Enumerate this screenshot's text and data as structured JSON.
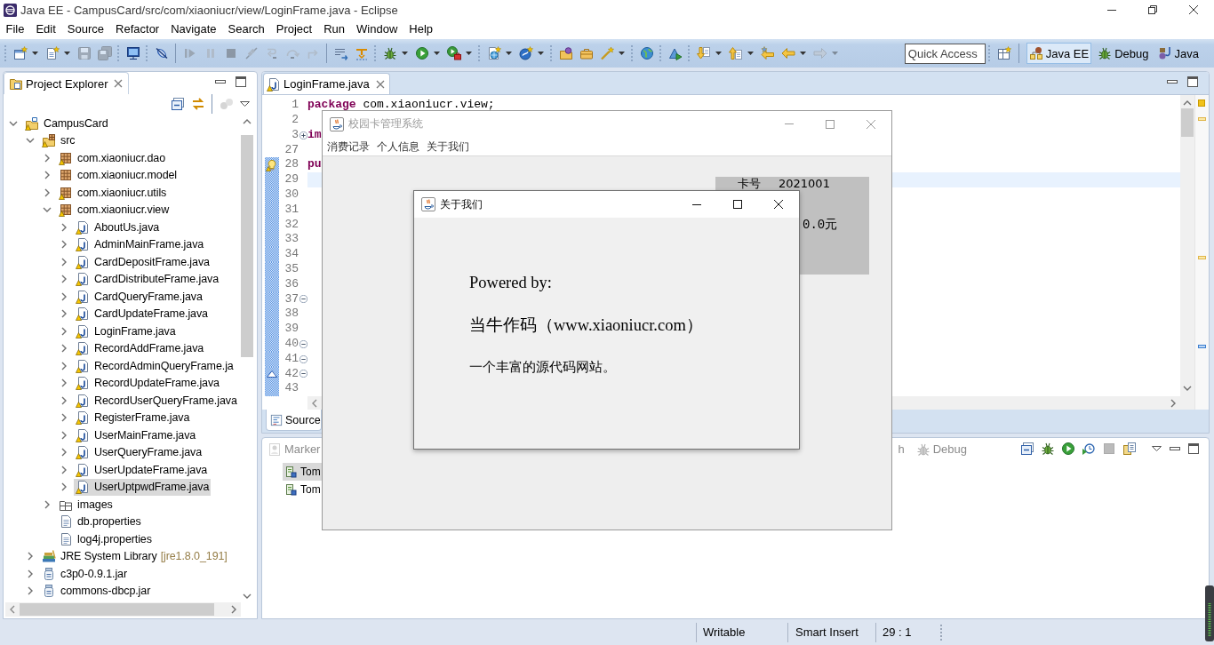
{
  "window": {
    "title": "Java EE - CampusCard/src/com/xiaoniucr/view/LoginFrame.java - Eclipse"
  },
  "menu": [
    "File",
    "Edit",
    "Source",
    "Refactor",
    "Navigate",
    "Search",
    "Project",
    "Run",
    "Window",
    "Help"
  ],
  "toolbar": [
    {
      "kind": "grip",
      "items": [
        {
          "kind": "new",
          "disabled": false,
          "dropdown": true
        },
        {
          "kind": "newfile",
          "disabled": false,
          "dropdown": true
        },
        {
          "kind": "save",
          "disabled": true,
          "dropdown": false
        },
        {
          "kind": "saveall",
          "disabled": true,
          "dropdown": false
        }
      ]
    },
    {
      "kind": "grip",
      "items": [
        {
          "kind": "console",
          "disabled": false,
          "dropdown": false
        }
      ]
    },
    {
      "kind": "grip",
      "items": [
        {
          "kind": "skip",
          "disabled": false,
          "dropdown": false
        }
      ]
    },
    {
      "kind": "line",
      "items": [
        {
          "kind": "resume",
          "disabled": true,
          "dropdown": false
        },
        {
          "kind": "suspend",
          "disabled": true,
          "dropdown": false
        },
        {
          "kind": "terminate",
          "disabled": true,
          "dropdown": false
        },
        {
          "kind": "disconnect",
          "disabled": true,
          "dropdown": false
        },
        {
          "kind": "stepinto",
          "disabled": true,
          "dropdown": false
        },
        {
          "kind": "stepover",
          "disabled": true,
          "dropdown": false
        },
        {
          "kind": "stepreturn",
          "disabled": true,
          "dropdown": false
        }
      ]
    },
    {
      "kind": "line",
      "items": [
        {
          "kind": "dropframe",
          "disabled": false,
          "dropdown": false
        },
        {
          "kind": "stepfilter",
          "disabled": false,
          "dropdown": false
        }
      ]
    },
    {
      "kind": "grip",
      "items": [
        {
          "kind": "debug",
          "disabled": false,
          "dropdown": true
        },
        {
          "kind": "run",
          "disabled": false,
          "dropdown": true
        },
        {
          "kind": "tools",
          "disabled": false,
          "dropdown": true
        }
      ]
    },
    {
      "kind": "grip",
      "items": [
        {
          "kind": "server",
          "disabled": false,
          "dropdown": true
        },
        {
          "kind": "servlet",
          "disabled": false,
          "dropdown": true
        }
      ]
    },
    {
      "kind": "grip",
      "items": [
        {
          "kind": "openfolder",
          "disabled": false,
          "dropdown": false
        },
        {
          "kind": "briefcase",
          "disabled": false,
          "dropdown": false
        },
        {
          "kind": "wand",
          "disabled": false,
          "dropdown": true
        }
      ]
    },
    {
      "kind": "grip",
      "items": [
        {
          "kind": "globe",
          "disabled": false,
          "dropdown": false
        }
      ]
    },
    {
      "kind": "grip",
      "items": [
        {
          "kind": "launch",
          "disabled": false,
          "dropdown": false
        }
      ]
    },
    {
      "kind": "grip",
      "items": [
        {
          "kind": "nextann",
          "disabled": false,
          "dropdown": true
        },
        {
          "kind": "prevann",
          "disabled": false,
          "dropdown": true
        },
        {
          "kind": "lastedit",
          "disabled": false,
          "dropdown": false
        },
        {
          "kind": "back",
          "disabled": false,
          "dropdown": true
        },
        {
          "kind": "forward",
          "disabled": true,
          "dropdown": true
        }
      ]
    }
  ],
  "quick_access": {
    "placeholder": "Quick Access"
  },
  "perspectives": [
    {
      "kind": "javaee",
      "label": "Java EE",
      "selected": true
    },
    {
      "kind": "debug",
      "label": "Debug",
      "selected": false
    },
    {
      "kind": "java",
      "label": "Java",
      "selected": false
    }
  ],
  "project_explorer": {
    "tab": {
      "label": "Project Explorer",
      "selected": true
    },
    "toolbar": [
      {
        "items": [
          {
            "kind": "collapse",
            "disabled": false,
            "dropdown": false
          },
          {
            "kind": "link",
            "disabled": false,
            "dropdown": false
          }
        ]
      },
      {
        "kind": "line",
        "items": [
          {
            "kind": "focus",
            "disabled": true,
            "dropdown": false
          }
        ]
      }
    ],
    "tree": [
      {
        "label": "CampusCard",
        "kind": "project",
        "warning": true,
        "expanded": true,
        "selected": false,
        "children": [
          {
            "label": "src",
            "kind": "srcfolder",
            "warning": true,
            "expanded": true,
            "selected": false,
            "children": [
              {
                "label": "com.xiaoniucr.dao",
                "kind": "package",
                "warning": true,
                "expanded": false,
                "selected": false
              },
              {
                "label": "com.xiaoniucr.model",
                "kind": "package",
                "warning": false,
                "expanded": false,
                "selected": false
              },
              {
                "label": "com.xiaoniucr.utils",
                "kind": "package",
                "warning": true,
                "expanded": false,
                "selected": false
              },
              {
                "label": "com.xiaoniucr.view",
                "kind": "package",
                "warning": true,
                "expanded": true,
                "selected": false,
                "children": [
                  {
                    "label": "AboutUs.java",
                    "kind": "java",
                    "warning": true,
                    "expanded": false,
                    "selected": false
                  },
                  {
                    "label": "AdminMainFrame.java",
                    "kind": "java",
                    "warning": true,
                    "expanded": false,
                    "selected": false
                  },
                  {
                    "label": "CardDepositFrame.java",
                    "kind": "java",
                    "warning": true,
                    "expanded": false,
                    "selected": false
                  },
                  {
                    "label": "CardDistributeFrame.java",
                    "kind": "java",
                    "warning": true,
                    "expanded": false,
                    "selected": false
                  },
                  {
                    "label": "CardQueryFrame.java",
                    "kind": "java",
                    "warning": true,
                    "expanded": false,
                    "selected": false
                  },
                  {
                    "label": "CardUpdateFrame.java",
                    "kind": "java",
                    "warning": true,
                    "expanded": false,
                    "selected": false
                  },
                  {
                    "label": "LoginFrame.java",
                    "kind": "java",
                    "warning": true,
                    "expanded": false,
                    "selected": false
                  },
                  {
                    "label": "RecordAddFrame.java",
                    "kind": "java",
                    "warning": true,
                    "expanded": false,
                    "selected": false
                  },
                  {
                    "label": "RecordAdminQueryFrame.ja",
                    "kind": "java",
                    "warning": true,
                    "expanded": false,
                    "selected": false
                  },
                  {
                    "label": "RecordUpdateFrame.java",
                    "kind": "java",
                    "warning": true,
                    "expanded": false,
                    "selected": false
                  },
                  {
                    "label": "RecordUserQueryFrame.java",
                    "kind": "java",
                    "warning": true,
                    "expanded": false,
                    "selected": false
                  },
                  {
                    "label": "RegisterFrame.java",
                    "kind": "java",
                    "warning": true,
                    "expanded": false,
                    "selected": false
                  },
                  {
                    "label": "UserMainFrame.java",
                    "kind": "java",
                    "warning": true,
                    "expanded": false,
                    "selected": false
                  },
                  {
                    "label": "UserQueryFrame.java",
                    "kind": "java",
                    "warning": true,
                    "expanded": false,
                    "selected": false
                  },
                  {
                    "label": "UserUpdateFrame.java",
                    "kind": "java",
                    "warning": true,
                    "expanded": false,
                    "selected": false
                  },
                  {
                    "label": "UserUptpwdFrame.java",
                    "kind": "java",
                    "warning": true,
                    "expanded": false,
                    "selected": true
                  }
                ]
              },
              {
                "label": "images",
                "kind": "folder",
                "warning": false,
                "expanded": false,
                "selected": false
              },
              {
                "label": "db.properties",
                "kind": "file",
                "warning": false,
                "selected": false
              },
              {
                "label": "log4j.properties",
                "kind": "file",
                "warning": false,
                "selected": false
              }
            ]
          },
          {
            "label": "JRE System Library",
            "decoration": "[jre1.8.0_191]",
            "kind": "library",
            "warning": false,
            "expanded": false,
            "selected": false
          },
          {
            "label": "c3p0-0.9.1.jar",
            "kind": "jar",
            "warning": false,
            "expanded": false,
            "selected": false
          },
          {
            "label": "commons-dbcp.jar",
            "kind": "jar",
            "warning": false,
            "expanded": false,
            "selected": false
          }
        ]
      }
    ]
  },
  "editor": {
    "tab": {
      "label": "LoginFrame.java",
      "warning": true,
      "selected": true
    },
    "lines": [
      {
        "number": "1",
        "tokens": [
          {
            "text": "package",
            "kind": "keyword"
          },
          {
            "text": " com.xiaoniucr.view;",
            "kind": "plain"
          }
        ],
        "changed": false,
        "current": false
      },
      {
        "number": "2",
        "changed": false,
        "current": false
      },
      {
        "number": "3",
        "tokens": [
          {
            "text": "im",
            "kind": "keyword"
          }
        ],
        "fold": {
          "expanded": false
        },
        "changed": false,
        "current": false
      },
      {
        "number": "27",
        "changed": false,
        "current": false
      },
      {
        "number": "28",
        "tokens": [
          {
            "text": "pu",
            "kind": "keyword"
          }
        ],
        "marker": {
          "kind": "warning"
        },
        "changed": true,
        "current": false
      },
      {
        "number": "29",
        "changed": true,
        "current": true
      },
      {
        "number": "30",
        "changed": true,
        "current": false
      },
      {
        "number": "31",
        "changed": true,
        "current": false
      },
      {
        "number": "32",
        "changed": true,
        "current": false
      },
      {
        "number": "33",
        "changed": true,
        "current": false
      },
      {
        "number": "34",
        "changed": true,
        "current": false
      },
      {
        "number": "35",
        "changed": true,
        "current": false
      },
      {
        "number": "36",
        "changed": true,
        "current": false
      },
      {
        "number": "37",
        "fold": {
          "expanded": true
        },
        "changed": true,
        "current": false
      },
      {
        "number": "38",
        "changed": true,
        "current": false
      },
      {
        "number": "39",
        "changed": true,
        "current": false
      },
      {
        "number": "40",
        "fold": {
          "expanded": true
        },
        "changed": true,
        "current": false
      },
      {
        "number": "41",
        "fold": {
          "expanded": true
        },
        "changed": true,
        "current": false
      },
      {
        "number": "42",
        "fold": {
          "expanded": true
        },
        "marker": {
          "kind": "override"
        },
        "changed": true,
        "current": false
      },
      {
        "number": "43",
        "changed": true,
        "current": false
      }
    ],
    "bottom_tabs": [
      {
        "label": "Source",
        "selected": true
      }
    ]
  },
  "bottom_panel": {
    "tabs": [
      {
        "kind": "markers",
        "label": "Marker",
        "selected": false
      },
      {
        "kind": "plain",
        "label": "h",
        "selected": false
      },
      {
        "kind": "debug",
        "label": "Debug",
        "selected": false
      }
    ],
    "toolbar": [
      {
        "items": [
          {
            "kind": "collapse",
            "disabled": false,
            "dropdown": false
          },
          {
            "kind": "debug",
            "disabled": false,
            "dropdown": false
          },
          {
            "kind": "run",
            "disabled": false,
            "dropdown": false
          },
          {
            "kind": "profile",
            "disabled": false,
            "dropdown": false
          },
          {
            "kind": "stop",
            "disabled": true,
            "dropdown": false
          },
          {
            "kind": "publish",
            "disabled": false,
            "dropdown": false
          }
        ]
      }
    ],
    "rows": [
      {
        "label": "Tom",
        "selected": true
      },
      {
        "label": "Tom",
        "selected": false
      }
    ]
  },
  "status_bar": [
    "Writable",
    "Smart Insert",
    "29 : 1"
  ],
  "app_window": {
    "title": "校园卡管理系统",
    "active": false,
    "menu": [
      "消费记录",
      "个人信息",
      "关于我们"
    ],
    "card_panel": {
      "card_label": "卡号",
      "card_number": "2021001",
      "balance": "0.0元"
    }
  },
  "about_dialog": {
    "title": "关于我们",
    "active": true,
    "lines": [
      {
        "kind": "large",
        "text": "Powered by:"
      },
      {
        "kind": "large",
        "text": "当牛作码（www.xiaoniucr.com）"
      },
      {
        "kind": "small",
        "text": "一个丰富的源代码网站。"
      }
    ]
  }
}
